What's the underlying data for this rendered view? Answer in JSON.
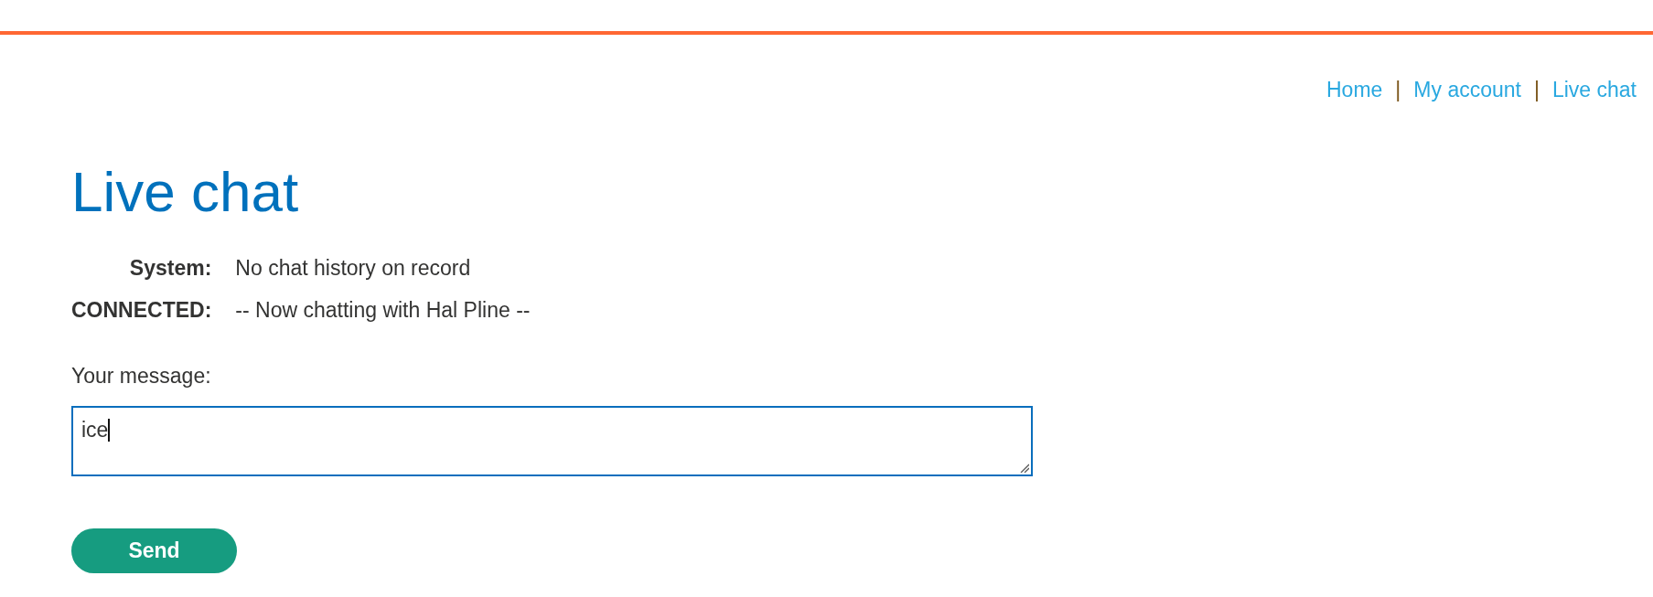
{
  "nav": [
    {
      "kind": "link",
      "label": "Home"
    },
    {
      "kind": "separator",
      "label": "|"
    },
    {
      "kind": "link",
      "label": "My account"
    },
    {
      "kind": "separator",
      "label": "|"
    },
    {
      "kind": "link",
      "label": "Live chat"
    }
  ],
  "title": "Live chat",
  "chat": [
    {
      "sender": "System:",
      "message": "No chat history on record"
    },
    {
      "sender": "CONNECTED:",
      "message": "-- Now chatting with Hal Pline --"
    }
  ],
  "message_form": {
    "label": "Your message:",
    "value": "ice",
    "focused": true,
    "button": "Send"
  }
}
